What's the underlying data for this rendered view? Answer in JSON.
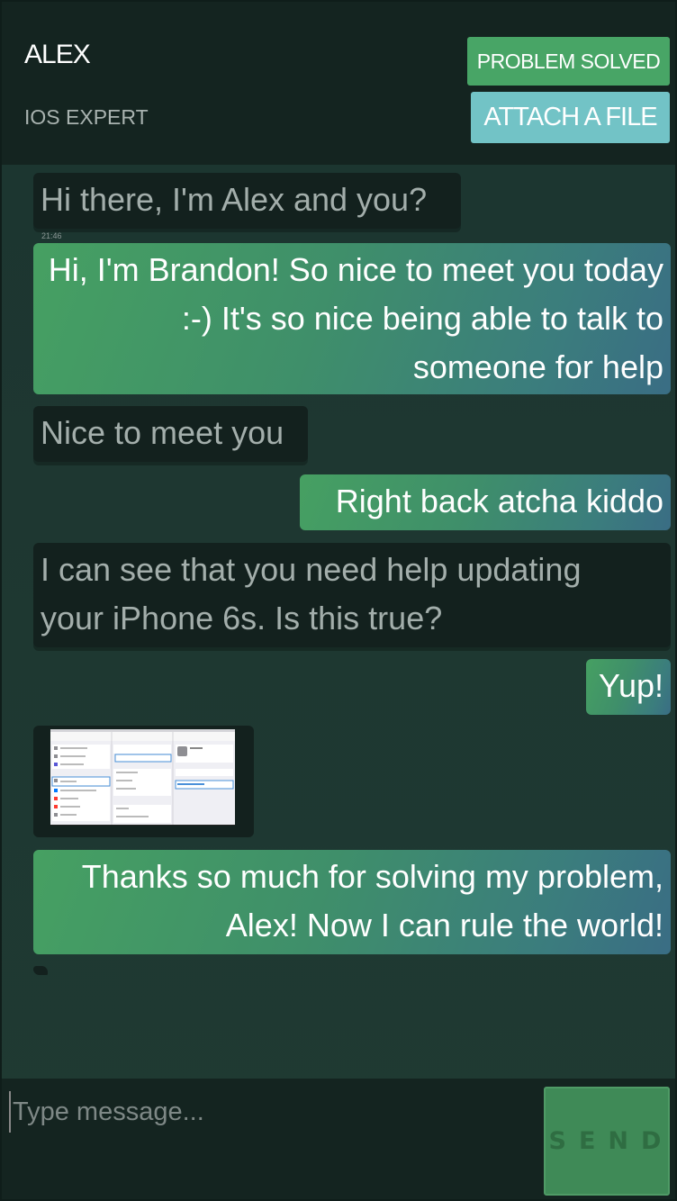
{
  "header": {
    "agent_name": "ALEX",
    "agent_role": "IOS EXPERT",
    "solved_button": "PROBLEM SOLVED",
    "attach_button": "ATTACH A FILE"
  },
  "messages": [
    {
      "from": "agent",
      "text": "Hi there, I'm Alex and you?",
      "time": "21:46"
    },
    {
      "from": "user",
      "text": "Hi, I'm Brandon! So nice to meet you today :-) It's so nice being able to talk to someone for help"
    },
    {
      "from": "agent",
      "text": "Nice to meet you"
    },
    {
      "from": "user",
      "text": "Right back atcha kiddo"
    },
    {
      "from": "agent",
      "text": "I can see that you need help updating your iPhone 6s. Is this true?"
    },
    {
      "from": "user",
      "text": "Yup!"
    },
    {
      "from": "agent",
      "attachment": "screenshot-image"
    },
    {
      "from": "user",
      "text": "Thanks so much for solving my problem, Alex! Now I can rule the world!"
    }
  ],
  "composer": {
    "placeholder": "Type message...",
    "send_label": "SEND"
  },
  "colors": {
    "header_bg": "#142420",
    "agent_bubble": "#13211e",
    "solved_button": "#48a566",
    "attach_button": "#72c3c6",
    "send_button": "#3f8a57"
  }
}
